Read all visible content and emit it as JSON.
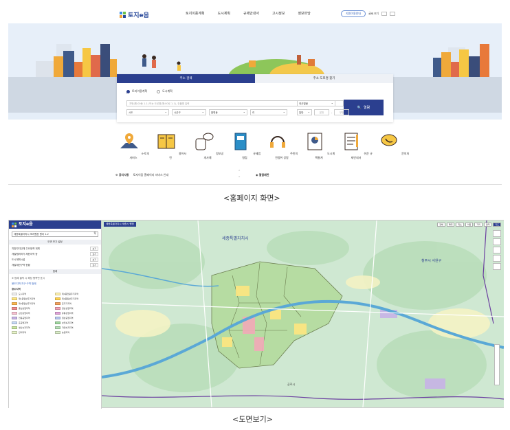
{
  "home": {
    "logo": "토지e음",
    "menu": [
      "토지이용계획",
      "도시계획",
      "규제안내서",
      "고시정보",
      "정보마당"
    ],
    "top_pill": "지원이용안내",
    "top_link": "글씨크기",
    "tabs": [
      "주소 검색",
      "주소 도로명 찾기"
    ],
    "radios": [
      "토지이용계획",
      "도시계획"
    ],
    "address_placeholder": "지번(예:00동 1-1) 또는 도로명(예:00로 1-1), 건물명 입력",
    "history_label": "최근열람",
    "selects": [
      "시도",
      "시군구",
      "읍면동",
      "리"
    ],
    "select_sidebar": "일반",
    "bunji_placeholders": [
      "본번",
      "부번"
    ],
    "search_button": "열람",
    "services": [
      "e-토지서비스",
      "용어사전",
      "정보공개사례",
      "규제법령집",
      "주민의견청취 공람",
      "도시계획통계",
      "쉬운 규제안내서",
      "문의처"
    ],
    "notice_label": "공지사항",
    "notice_text": "토지이음 홈페이지 서비스 안내",
    "extra_label": "열람제한",
    "caption": "<홈페이지 화면>"
  },
  "mapview": {
    "logo": "토지e음",
    "search_value": "세종특별자치시 조치원읍 원리 1-2",
    "section_display": "도면 보기 설정",
    "rows": [
      {
        "label": "지방자치단체 주요정책 계획",
        "btn": "보기"
      },
      {
        "label": "개발행위허가 제한지역 등",
        "btn": "보기"
      },
      {
        "label": "도시계획시설",
        "btn": "보기"
      },
      {
        "label": "개발제한구역 현황",
        "btn": "보기"
      }
    ],
    "section_legend": "범례",
    "legend_note": "※ 범례 클릭 시 해당 항목만 표시",
    "legend_link": "용도지역·지구·구역 범례",
    "legend_head": "용도지역",
    "legend_items": [
      {
        "name": "도시지역",
        "color": "#f2f2f2"
      },
      {
        "name": "제1종전용주거지역",
        "color": "#fff3b0"
      },
      {
        "name": "제1종일반주거지역",
        "color": "#ffe680"
      },
      {
        "name": "제2종일반주거지역",
        "color": "#ffd24d"
      },
      {
        "name": "제3종일반주거지역",
        "color": "#ffb84d"
      },
      {
        "name": "준주거지역",
        "color": "#f7a35c"
      },
      {
        "name": "중심상업지역",
        "color": "#f28c8c"
      },
      {
        "name": "일반상업지역",
        "color": "#f5a3b8"
      },
      {
        "name": "근린상업지역",
        "color": "#f7c0d0"
      },
      {
        "name": "유통상업지역",
        "color": "#e0a3d9"
      },
      {
        "name": "전용공업지역",
        "color": "#c7b3e6"
      },
      {
        "name": "일반공업지역",
        "color": "#b8c7f0"
      },
      {
        "name": "준공업지역",
        "color": "#c5d9f5"
      },
      {
        "name": "보전녹지지역",
        "color": "#9ed69e"
      },
      {
        "name": "생산녹지지역",
        "color": "#c8e6a0"
      },
      {
        "name": "자연녹지지역",
        "color": "#b5e0b5"
      },
      {
        "name": "관리지역",
        "color": "#e8f5c8"
      },
      {
        "name": "농림지역",
        "color": "#dbeec9"
      }
    ],
    "map_badge": "세종특별자치시 세종시 행정",
    "map_tools": [
      "전체",
      "확대",
      "축소",
      "이동",
      "거리",
      "면적",
      "지도"
    ],
    "map_labels": [
      "세종특별자치시",
      "청주시 서원구",
      "공주시"
    ],
    "caption": "<도면보기>"
  }
}
